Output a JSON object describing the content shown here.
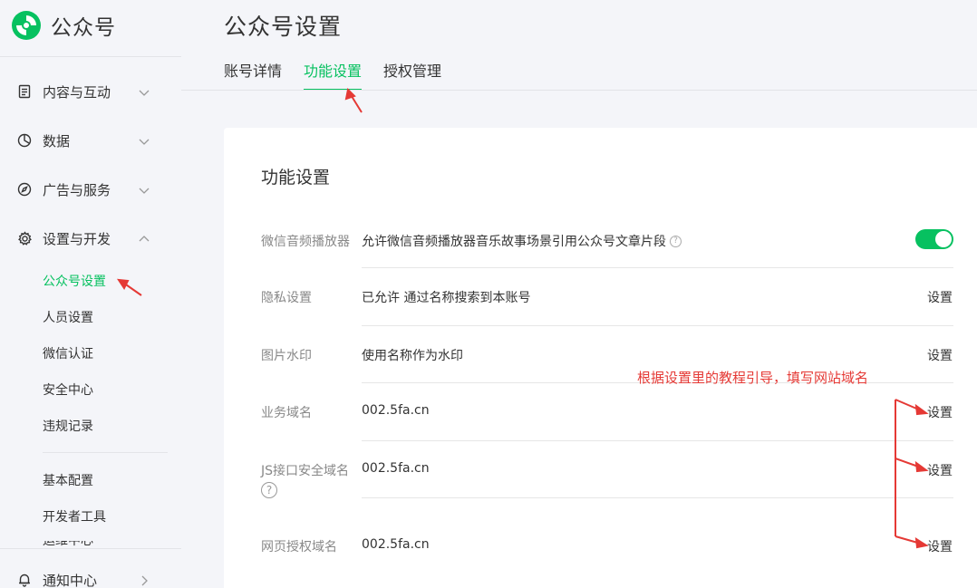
{
  "app": {
    "name": "公众号"
  },
  "sidebar": {
    "sections": [
      {
        "label": "内容与互动",
        "icon": "document-icon"
      },
      {
        "label": "数据",
        "icon": "pie-chart-icon"
      },
      {
        "label": "广告与服务",
        "icon": "compass-icon"
      },
      {
        "label": "设置与开发",
        "icon": "gear-icon"
      }
    ],
    "sub_items": [
      {
        "label": "公众号设置",
        "active": true
      },
      {
        "label": "人员设置"
      },
      {
        "label": "微信认证"
      },
      {
        "label": "安全中心"
      },
      {
        "label": "违规记录"
      },
      {
        "label": "基本配置"
      },
      {
        "label": "开发者工具"
      },
      {
        "label": "运维中心"
      }
    ],
    "notification": {
      "label": "通知中心",
      "icon": "bell-icon"
    }
  },
  "page": {
    "title": "公众号设置",
    "tabs": [
      {
        "label": "账号详情"
      },
      {
        "label": "功能设置",
        "active": true
      },
      {
        "label": "授权管理"
      }
    ]
  },
  "card": {
    "title": "功能设置",
    "rows": [
      {
        "label": "微信音频播放器",
        "value": "允许微信音频播放器音乐故事场景引用公众号文章片段",
        "toggle_on": true
      },
      {
        "label": "隐私设置",
        "value": "已允许 通过名称搜索到本账号",
        "action": "设置"
      },
      {
        "label": "图片水印",
        "value": "使用名称作为水印",
        "action": "设置"
      },
      {
        "label": "业务域名",
        "value": "002.5fa.cn",
        "action": "设置"
      },
      {
        "label": "JS接口安全域名",
        "value": "002.5fa.cn",
        "action": "设置"
      },
      {
        "label": "网页授权域名",
        "value": "002.5fa.cn",
        "action": "设置"
      }
    ]
  },
  "annotation": {
    "text": "根据设置里的教程引导，填写网站域名"
  },
  "colors": {
    "accent": "#07c160",
    "annotation": "#e53935",
    "background": "#f4f5f9"
  }
}
